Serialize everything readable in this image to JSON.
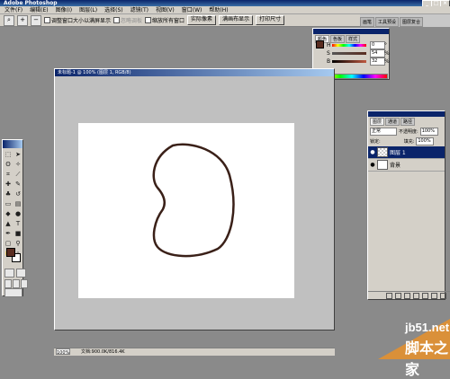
{
  "app": {
    "title": "Adobe Photoshop"
  },
  "menu": [
    "文件(F)",
    "编辑(E)",
    "图像(I)",
    "图层(L)",
    "选择(S)",
    "滤镜(T)",
    "视图(V)",
    "窗口(W)",
    "帮助(H)"
  ],
  "options_bar": {
    "resize_window": "调整窗口大小以满屏显示",
    "ignore_palettes": "忽略调板",
    "zoom_all": "缩放所有窗口",
    "actual_pixels": "实际像素",
    "fit_screen": "满画布显示",
    "print_size": "打印尺寸"
  },
  "dock_tabs": [
    "画笔",
    "工具预设",
    "图层复合"
  ],
  "color_panel": {
    "tabs": [
      "颜色",
      "色板",
      "样式"
    ],
    "channels": [
      {
        "label": "H",
        "value": "0",
        "unit": "°"
      },
      {
        "label": "S",
        "value": "54",
        "unit": "%"
      },
      {
        "label": "B",
        "value": "32",
        "unit": "%"
      }
    ],
    "foreground": "#5a2d21",
    "background": "#ffffff"
  },
  "document": {
    "title": "未标题-1 @ 100% (图层 1, RGB/8)",
    "shape_color": "#3a2018",
    "zoom": "100%",
    "doc_size": "文档:900.0K/816.4K"
  },
  "layers_panel": {
    "tabs": [
      "图层",
      "通道",
      "路径"
    ],
    "blend_mode": "正常",
    "opacity_label": "不透明度:",
    "opacity": "100%",
    "lock_label": "锁定:",
    "fill_label": "填充:",
    "fill": "100%",
    "layers": [
      {
        "name": "图层 1",
        "selected": true
      },
      {
        "name": "背景",
        "selected": false
      }
    ]
  },
  "watermark": {
    "site": "jb51.net",
    "cn": "脚本之家"
  }
}
